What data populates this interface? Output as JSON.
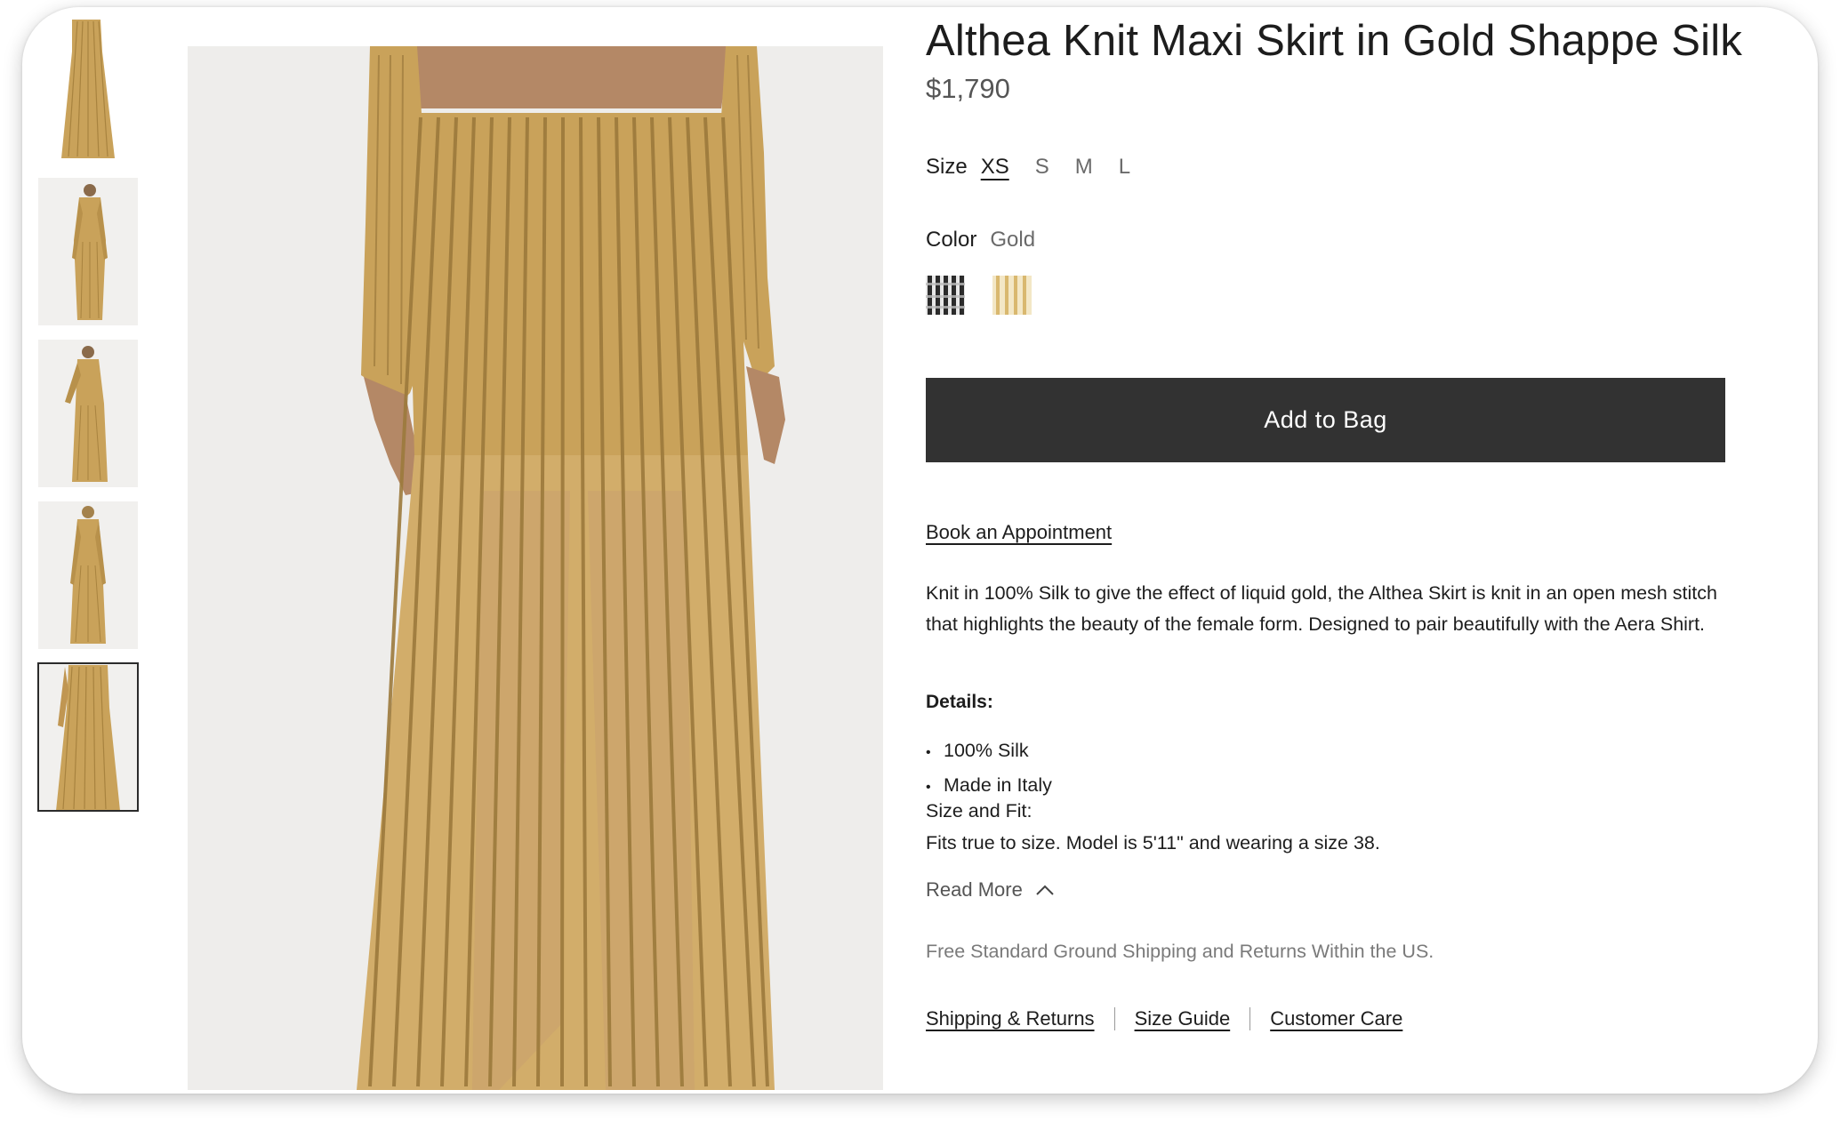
{
  "product": {
    "title": "Althea Knit Maxi Skirt in Gold Shappe Silk",
    "price": "$1,790"
  },
  "size": {
    "label": "Size",
    "options": [
      "XS",
      "S",
      "M",
      "L"
    ],
    "selected": "XS"
  },
  "color": {
    "label": "Color",
    "value": "Gold",
    "swatches": [
      {
        "name": "black-white",
        "hex": "#3a3a3a"
      },
      {
        "name": "gold",
        "hex": "#e7cf93"
      }
    ]
  },
  "actions": {
    "add_to_bag": "Add to Bag",
    "book_appointment": "Book an Appointment"
  },
  "description": "Knit in 100% Silk to give the effect of liquid gold, the Althea Skirt is knit in an open mesh stitch that highlights the beauty of the female form. Designed to pair beautifully with the Aera Shirt.",
  "details": {
    "heading": "Details:",
    "items": [
      "100% Silk",
      "Made in Italy"
    ],
    "fit_heading": "Size and Fit:",
    "fit_text": "Fits true to size. Model is 5'11\" and wearing a size 38."
  },
  "read_more": "Read More",
  "shipping_note": "Free Standard Ground Shipping and Returns Within the US.",
  "footer_links": [
    "Shipping & Returns",
    "Size Guide",
    "Customer Care"
  ],
  "gallery": {
    "thumbnail_count": 5,
    "active_index": 4
  },
  "colors": {
    "gold": "#c9a25a",
    "button": "#323232",
    "image_bg": "#eeedeb"
  }
}
